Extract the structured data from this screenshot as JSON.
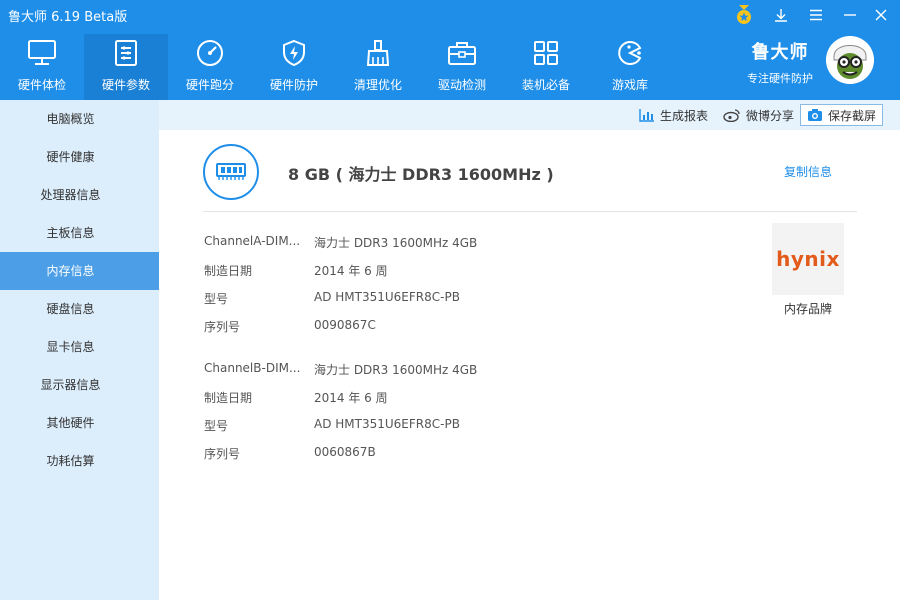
{
  "window": {
    "title": "鲁大师 6.19 Beta版"
  },
  "toolbar": {
    "items": [
      {
        "label": "硬件体检",
        "icon": "monitor-icon"
      },
      {
        "label": "硬件参数",
        "icon": "spec-list-icon",
        "active": true
      },
      {
        "label": "硬件跑分",
        "icon": "speedometer-icon"
      },
      {
        "label": "硬件防护",
        "icon": "shield-bolt-icon"
      },
      {
        "label": "清理优化",
        "icon": "broom-icon"
      },
      {
        "label": "驱动检测",
        "icon": "toolbox-icon"
      },
      {
        "label": "装机必备",
        "icon": "apps-grid-icon"
      },
      {
        "label": "游戏库",
        "icon": "game-icon"
      }
    ]
  },
  "brand": {
    "name": "鲁大师",
    "slogan": "专注硬件防护"
  },
  "sidebar": {
    "items": [
      {
        "label": "电脑概览"
      },
      {
        "label": "硬件健康"
      },
      {
        "label": "处理器信息"
      },
      {
        "label": "主板信息"
      },
      {
        "label": "内存信息",
        "active": true
      },
      {
        "label": "硬盘信息"
      },
      {
        "label": "显卡信息"
      },
      {
        "label": "显示器信息"
      },
      {
        "label": "其他硬件"
      },
      {
        "label": "功耗估算"
      }
    ]
  },
  "actions": {
    "report": "生成报表",
    "weibo": "微博分享",
    "save": "保存截屏"
  },
  "memory": {
    "summary": "8 GB ( 海力士 DDR3 1600MHz )",
    "copy_label": "复制信息",
    "brand_logo": "hynix",
    "brand_caption": "内存品牌",
    "slots": [
      {
        "rows": [
          {
            "label": "ChannelA-DIM...",
            "value": "海力士 DDR3 1600MHz 4GB"
          },
          {
            "label": "制造日期",
            "value": "2014 年 6 周"
          },
          {
            "label": "型号",
            "value": "AD HMT351U6EFR8C-PB"
          },
          {
            "label": "序列号",
            "value": "0090867C"
          }
        ]
      },
      {
        "rows": [
          {
            "label": "ChannelB-DIM...",
            "value": "海力士 DDR3 1600MHz 4GB"
          },
          {
            "label": "制造日期",
            "value": "2014 年 6 周"
          },
          {
            "label": "型号",
            "value": "AD HMT351U6EFR8C-PB"
          },
          {
            "label": "序列号",
            "value": "0060867B"
          }
        ]
      }
    ]
  },
  "colors": {
    "primary": "#1e8ee9",
    "sidebar_bg": "#dcedfb",
    "sidebar_active": "#4c9fe6",
    "brand_logo": "#e35b1b"
  }
}
